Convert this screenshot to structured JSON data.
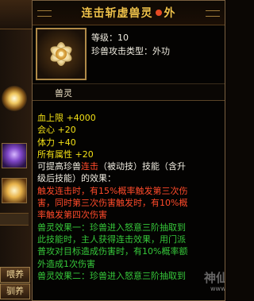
{
  "tooltip": {
    "title": "连击斩虚兽灵",
    "title_suffix": "外",
    "level": "等级：10",
    "attack_type": "珍兽攻击类型：外功",
    "item_name": "兽灵",
    "stats": [
      {
        "text": "血上限 +4000",
        "color": "yellow"
      },
      {
        "text": "会心 +20",
        "color": "yellow"
      },
      {
        "text": "体力 +40",
        "color": "yellow"
      },
      {
        "text": "所有属性 +20",
        "color": "yellow"
      }
    ],
    "desc_line1_prefix": "可提高珍兽",
    "desc_line1_skill": "连击",
    "desc_line1_rest": "（被动技）技能（含升",
    "desc_line2": "级后技能）的效果：",
    "trigger_lines": [
      "触发连击时，有15%概率触发第三次伤",
      "害，同时第三次伤害触发时，有10%概",
      "率触发第四次伤害"
    ],
    "effect1_lines": [
      "兽灵效果一：珍兽进入怒意三阶抽取到",
      "此技能时，主人获得连击效果，用门派",
      "普攻对目标造成伤害时，有10%概率额",
      "外造成1次伤害"
    ],
    "effect2_line": "兽灵效果二：珍兽进入怒意三阶抽取到"
  },
  "sidebar": {
    "feed_label": "喂养",
    "tame_label": "驯养"
  },
  "watermark": {
    "brand": "神仙代售",
    "url": "www.SXDS.COM"
  },
  "colors": {
    "title": "#f0c24a",
    "stat_yellow": "#f2e016",
    "skill_red": "#ff4a2a",
    "effect_green": "#36c83a",
    "text_white": "#f0ece0"
  }
}
